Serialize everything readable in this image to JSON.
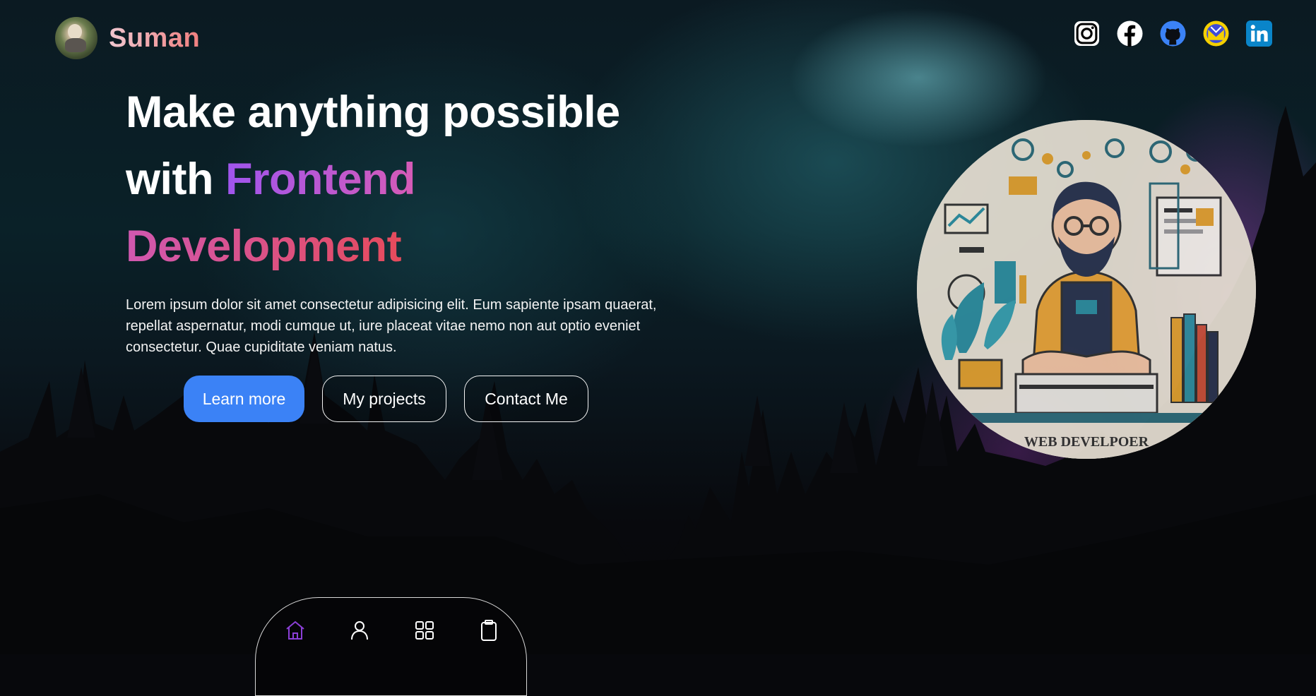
{
  "header": {
    "brand_name": "Suman",
    "avatar_icon": "avatar-photo",
    "socials": [
      {
        "name": "instagram",
        "icon": "instagram-icon",
        "color": "#ffffff"
      },
      {
        "name": "facebook",
        "icon": "facebook-icon",
        "color": "#ffffff"
      },
      {
        "name": "github",
        "icon": "github-icon",
        "color": "#3b82f6"
      },
      {
        "name": "email",
        "icon": "mail-icon",
        "color": "#f5d000"
      },
      {
        "name": "linkedin",
        "icon": "linkedin-icon",
        "color": "#0a85c9"
      }
    ]
  },
  "hero": {
    "title_line1": "Make anything possible",
    "title_with": "with",
    "title_highlight1": "Frontend",
    "title_highlight2": "Development",
    "description": "Lorem ipsum dolor sit amet consectetur adipisicing elit. Eum sapiente ipsam quaerat, repellat aspernatur, modi cumque ut, iure placeat vitae nemo non aut optio eveniet consectetur. Quae cupiditate veniam natus.",
    "buttons": {
      "learn_more": "Learn more",
      "my_projects": "My projects",
      "contact_me": "Contact Me"
    },
    "image": {
      "caption": "WEB DEVELPOER",
      "icon": "web-developer-illustration"
    }
  },
  "bottom_nav": {
    "items": [
      {
        "icon": "home-icon",
        "active": true
      },
      {
        "icon": "user-icon",
        "active": false
      },
      {
        "icon": "grid-icon",
        "active": false
      },
      {
        "icon": "clipboard-icon",
        "active": false
      }
    ]
  },
  "colors": {
    "primary_button": "#3b82f6",
    "brand_gradient": [
      "#f0c7d0",
      "#f07f7f"
    ],
    "highlight_gradient": [
      "#9f55ee",
      "#e54b5c"
    ],
    "active_nav": "#8b3fd6"
  }
}
